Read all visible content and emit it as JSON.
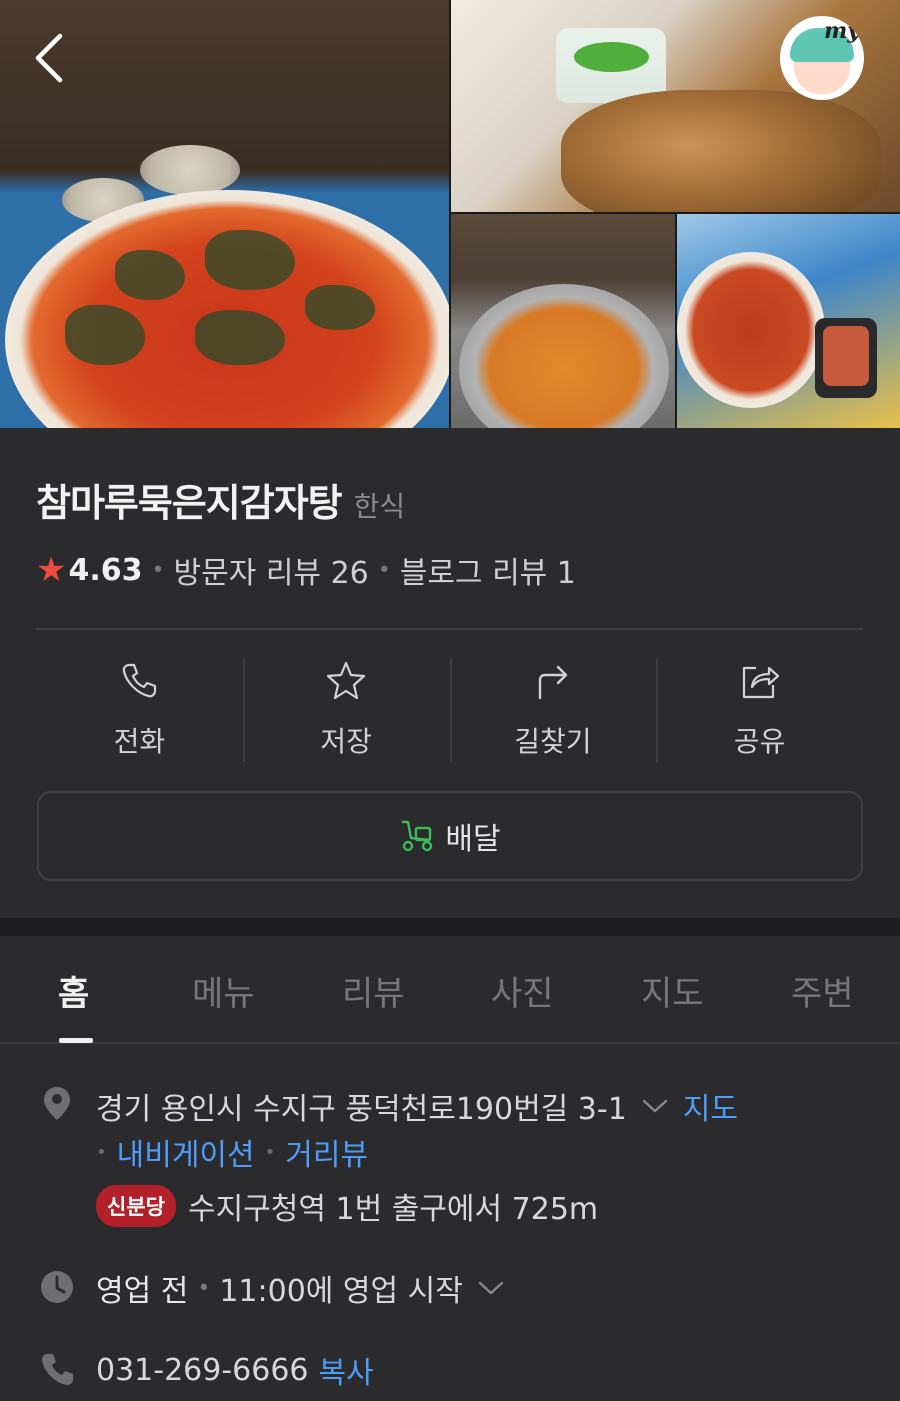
{
  "header": {
    "back_icon": "chevron-left-icon",
    "profile_badge": "my"
  },
  "place": {
    "name": "참마루묵은지감자탕",
    "category": "한식",
    "rating": "4.63",
    "visitor_reviews": "방문자 리뷰 26",
    "blog_reviews": "블로그 리뷰 1"
  },
  "actions": [
    {
      "label": "전화",
      "icon": "phone-icon"
    },
    {
      "label": "저장",
      "icon": "star-outline-icon"
    },
    {
      "label": "길찾기",
      "icon": "directions-arrow-icon"
    },
    {
      "label": "공유",
      "icon": "share-icon"
    }
  ],
  "delivery": {
    "label": "배달",
    "icon": "delivery-scooter-icon",
    "icon_color": "#3dbb5a"
  },
  "tabs": [
    "홈",
    "메뉴",
    "리뷰",
    "사진",
    "지도",
    "주변"
  ],
  "active_tab": "홈",
  "details": {
    "address": "경기 용인시 수지구 풍덕천로190번길 3-1",
    "map_link": "지도",
    "navigation_link": "내비게이션",
    "street_view_link": "거리뷰",
    "subway_line": "신분당",
    "subway_line_color": "#b3202a",
    "subway_directions": "수지구청역 1번 출구에서 725m",
    "hours_status": "영업 전",
    "hours_detail": "11:00에 영업 시작",
    "phone": "031-269-6666",
    "copy_label": "복사"
  },
  "colors": {
    "background": "#2b2b2d",
    "link_blue": "#4f9cf7",
    "rating_star": "#f04a3e"
  }
}
